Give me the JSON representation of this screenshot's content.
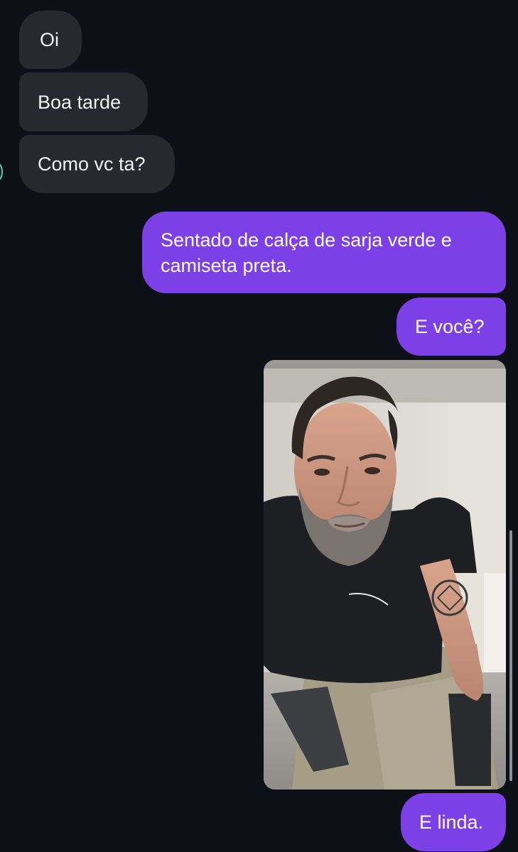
{
  "conversation": {
    "incoming": [
      {
        "text": "Oi"
      },
      {
        "text": "Boa tarde"
      },
      {
        "text": "Como vc ta?"
      }
    ],
    "outgoing": [
      {
        "text": "Sentado de calça de sarja verde e camiseta preta."
      },
      {
        "text": "E você?"
      },
      {
        "type": "photo",
        "description_icon": "selfie-photo"
      },
      {
        "text": "E linda."
      }
    ]
  },
  "colors": {
    "background": "#0d1117",
    "incoming_bubble": "#26292e",
    "outgoing_bubble": "#7d3fe6",
    "avatar_ring": "#4fd1b8"
  }
}
